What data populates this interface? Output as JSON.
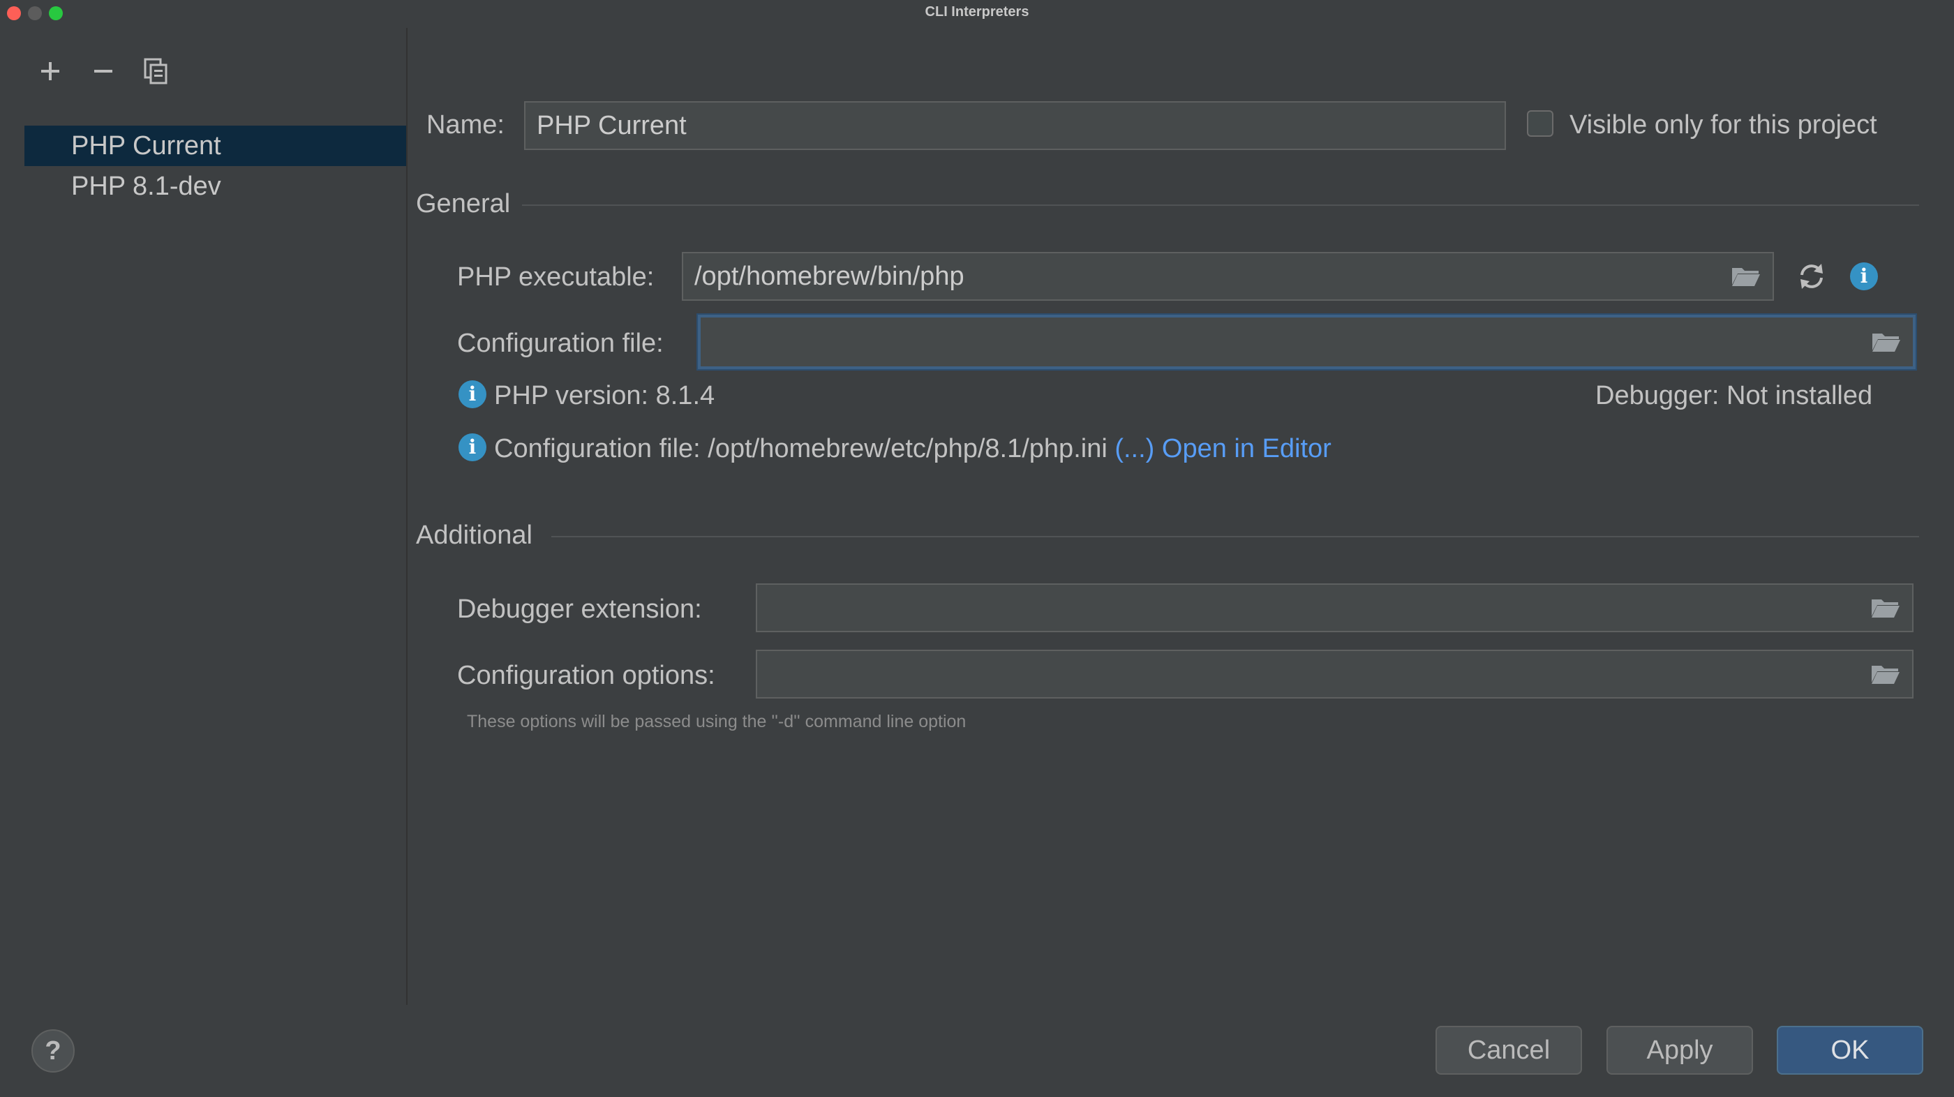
{
  "window": {
    "title": "CLI Interpreters"
  },
  "toolbar": {
    "add_icon": "plus-icon",
    "remove_icon": "minus-icon",
    "copy_icon": "copy-icon"
  },
  "interpreters": [
    {
      "label": "PHP Current",
      "selected": true
    },
    {
      "label": "PHP 8.1-dev",
      "selected": false
    }
  ],
  "name_row": {
    "label": "Name:",
    "value": "PHP Current",
    "checkbox_label": "Visible only for this project",
    "checkbox_checked": false
  },
  "general": {
    "title": "General",
    "php_executable_label": "PHP executable:",
    "php_executable_value": "/opt/homebrew/bin/php",
    "config_file_label": "Configuration file:",
    "config_file_value": "",
    "php_version_text": "PHP version: 8.1.4",
    "debugger_label": "Debugger:",
    "debugger_value": "Not installed",
    "config_info_text": "Configuration file: /opt/homebrew/etc/php/8.1/php.ini",
    "config_more_link": "(...)",
    "open_in_editor_link": "Open in Editor"
  },
  "additional": {
    "title": "Additional",
    "debugger_extension_label": "Debugger extension:",
    "debugger_extension_value": "",
    "config_options_label": "Configuration options:",
    "config_options_value": "",
    "hint": "These options will be passed using the ''-d'' command line option"
  },
  "buttons": {
    "help": "?",
    "cancel": "Cancel",
    "apply": "Apply",
    "ok": "OK"
  },
  "colors": {
    "background": "#3c3f41",
    "selection": "#0d293e",
    "accent_link": "#589df6",
    "info_icon": "#3592c4",
    "primary_button": "#365880"
  }
}
